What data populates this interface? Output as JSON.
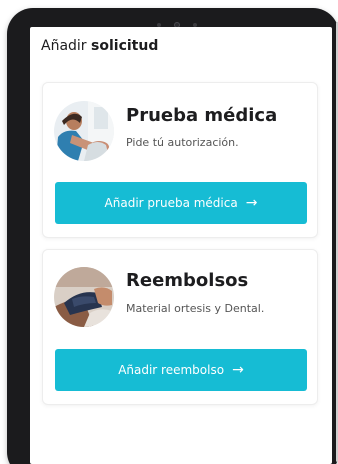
{
  "header": {
    "title_regular": "Añadir",
    "title_bold": "solicitud"
  },
  "cards": [
    {
      "title": "Prueba médica",
      "description": "Pide tú autorización.",
      "button_label": "Añadir prueba médica",
      "icon": "doctor-consultation-photo"
    },
    {
      "title": "Reembolsos",
      "description": "Material ortesis y Dental.",
      "button_label": "Añadir reembolso",
      "icon": "wrist-brace-photo"
    }
  ],
  "colors": {
    "accent": "#16bcd4",
    "text": "#1d1d1f"
  }
}
